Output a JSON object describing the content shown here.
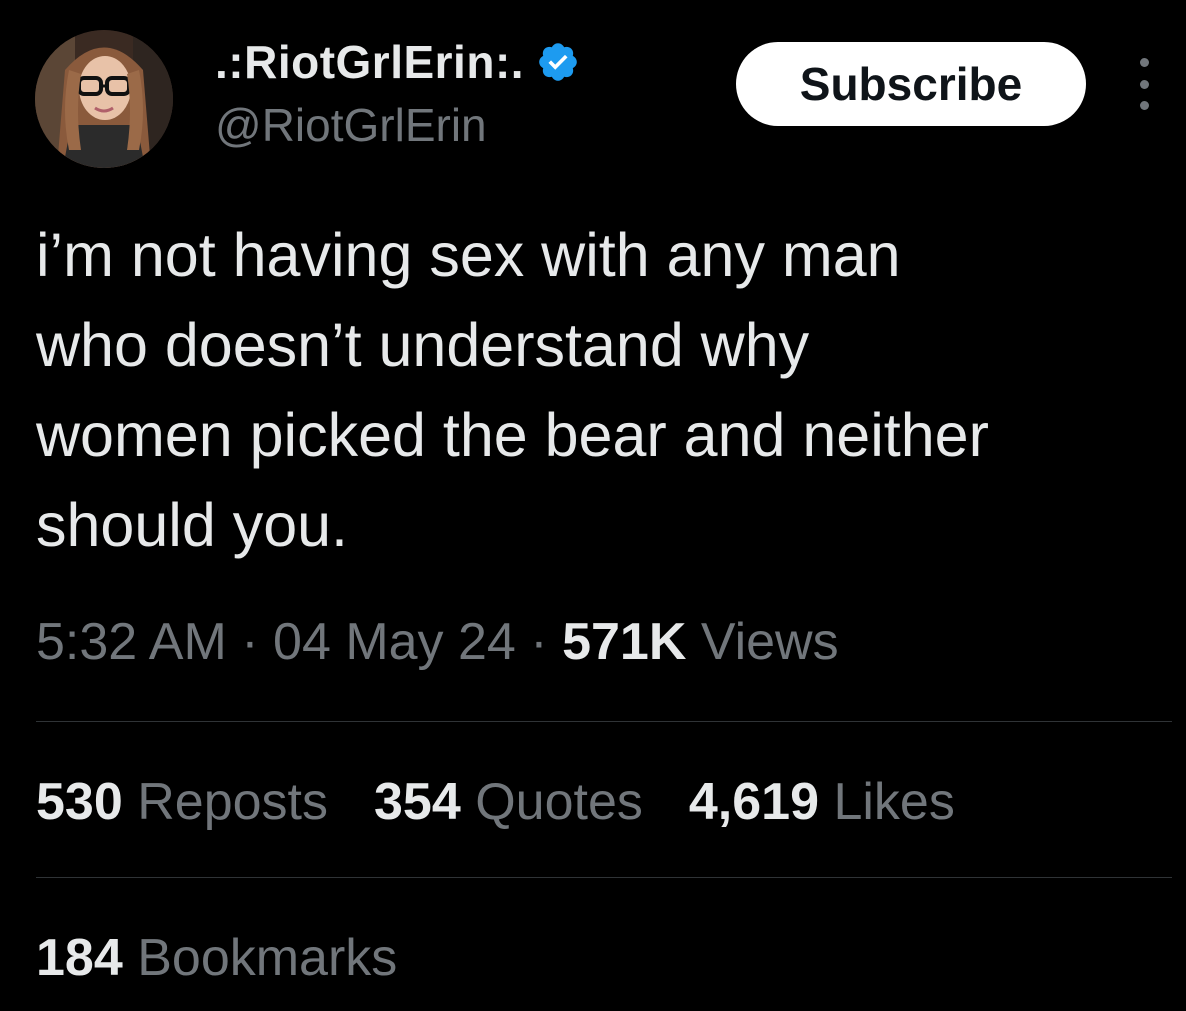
{
  "author": {
    "display_name": ".:RiotGrlErin:.",
    "handle": "@RiotGrlErin",
    "verified": true,
    "verified_color": "#1d9bf0"
  },
  "actions": {
    "subscribe_label": "Subscribe",
    "more_icon": "more-vertical-icon"
  },
  "tweet": {
    "text": "i’m not having sex with any man\nwho doesn’t understand why\nwomen picked the bear and neither\nshould you."
  },
  "meta": {
    "time": "5:32 AM",
    "separator": "·",
    "date": "04 May 24",
    "views_count": "571K",
    "views_label": "Views"
  },
  "stats": {
    "reposts_count": "530",
    "reposts_label": "Reposts",
    "quotes_count": "354",
    "quotes_label": "Quotes",
    "likes_count": "4,619",
    "likes_label": "Likes",
    "bookmarks_count": "184",
    "bookmarks_label": "Bookmarks"
  },
  "colors": {
    "background": "#000000",
    "primary_text": "#e7e9ea",
    "secondary_text": "#71767b",
    "divider": "#2f3336"
  }
}
